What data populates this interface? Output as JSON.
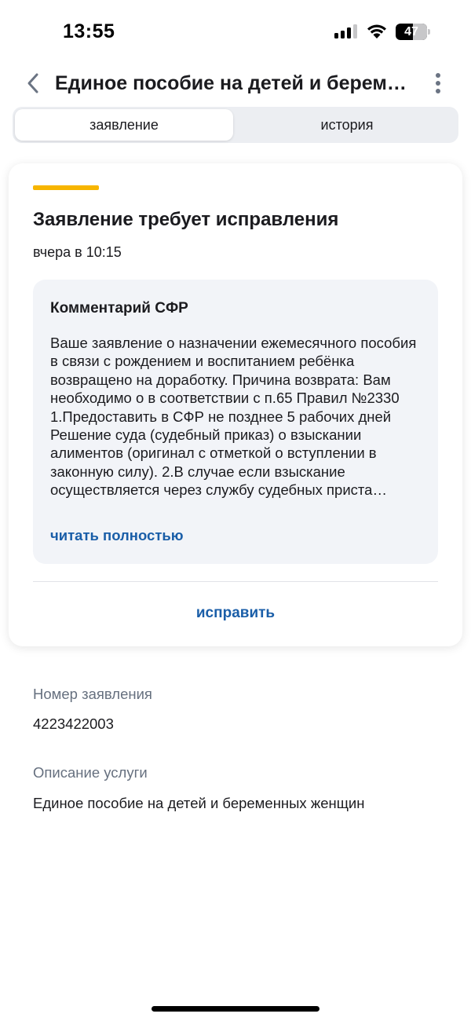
{
  "status_bar": {
    "time": "13:55",
    "battery_level": "47"
  },
  "header": {
    "back_icon": "chevron-left-icon",
    "title": "Единое пособие на детей и беременных женщин",
    "more_icon": "more-vertical-icon"
  },
  "tabs": [
    {
      "label": "заявление",
      "active": true
    },
    {
      "label": "история",
      "active": false
    }
  ],
  "card": {
    "status_color": "#f7b500",
    "title": "Заявление требует исправления",
    "date": "вчера в 10:15",
    "comment": {
      "title": "Комментарий СФР",
      "text": "Ваше заявление о назначении ежемесячного пособия в связи с рождением и воспитанием ребёнка возвращено на доработку. Причина возврата: Вам необходимо о в соответствии с п.65 Правил №2330 1.Предоставить в СФР не позднее 5 рабочих дней Решение суда (судебный приказ) о взыскании алиментов (оригинал с отметкой о вступлении в законную силу). 2.В случае если взыскание осуществляется через службу судебных приста…",
      "read_more": "читать полностью"
    },
    "fix_button": "исправить"
  },
  "info": {
    "application_number_label": "Номер заявления",
    "application_number": "4223422003",
    "service_label": "Описание услуги",
    "service_value": "Единое пособие на детей и беременных женщин"
  },
  "colors": {
    "accent": "#1a5ea8",
    "warning": "#f7b500",
    "muted_text": "#66707f"
  }
}
